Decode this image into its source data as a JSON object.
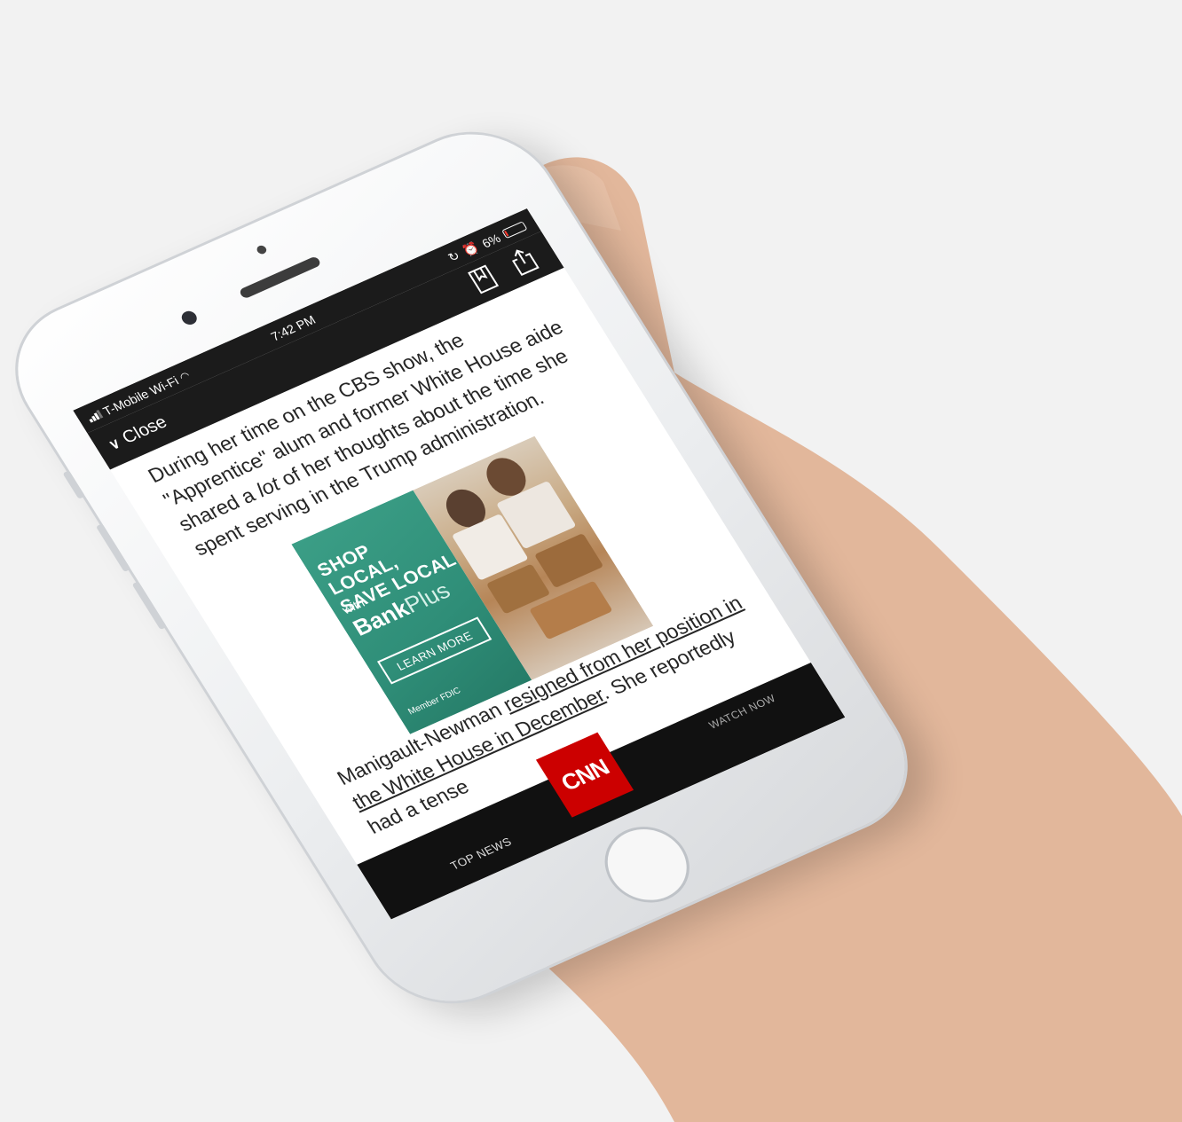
{
  "status_bar": {
    "carrier": "T-Mobile Wi-Fi",
    "time": "7:42 PM",
    "battery_text": "6%",
    "battery_level": 0.06,
    "icons": [
      "signal-icon",
      "wifi-icon",
      "orientation-lock-icon",
      "alarm-icon",
      "battery-icon"
    ]
  },
  "nav": {
    "close_label": "Close",
    "icons": [
      "chevron-down-icon",
      "bookmark-icon",
      "share-icon"
    ]
  },
  "article": {
    "para1_a": "During her time on the CBS show, the \"Apprentice\" alum and former White House aide shared a ",
    "para1_em": "lot",
    "para1_b": " of her thoughts about the time she spent serving in the Trump administration.",
    "para2_a": "Manigault-Newman ",
    "para2_link": "resigned from her position in the White House in December",
    "para2_b": ". She reportedly had a tense"
  },
  "ad": {
    "headline_line1": "SHOP LOCAL,",
    "headline_line2": "SAVE LOCAL",
    "with": "with",
    "brand_bold": "Bank",
    "brand_light": "Plus",
    "cta": "LEARN MORE",
    "fine_print": "Member FDIC",
    "colors": {
      "panel": "#2f8e78"
    }
  },
  "bottom_bar": {
    "left_label": "TOP NEWS",
    "right_label": "WATCH NOW",
    "logo_text": "CNN",
    "colors": {
      "logo": "#cc0000",
      "bar": "#111111"
    }
  }
}
